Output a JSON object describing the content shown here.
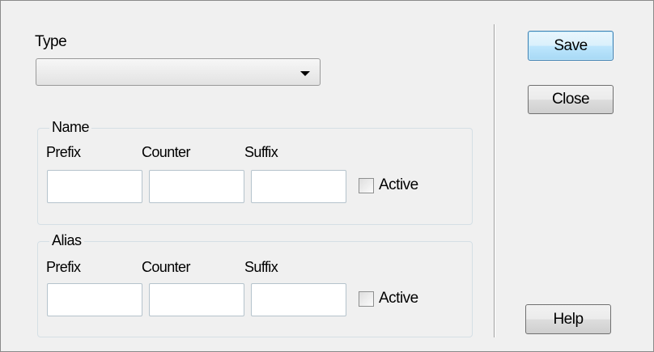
{
  "type_field": {
    "label": "Type",
    "value": ""
  },
  "name_group": {
    "title": "Name",
    "prefix_label": "Prefix",
    "counter_label": "Counter",
    "suffix_label": "Suffix",
    "prefix_value": "",
    "counter_value": "",
    "suffix_value": "",
    "active_label": "Active",
    "active_checked": false
  },
  "alias_group": {
    "title": "Alias",
    "prefix_label": "Prefix",
    "counter_label": "Counter",
    "suffix_label": "Suffix",
    "prefix_value": "",
    "counter_value": "",
    "suffix_value": "",
    "active_label": "Active",
    "active_checked": false
  },
  "buttons": {
    "save": "Save",
    "close": "Close",
    "help": "Help"
  },
  "colors": {
    "dialog_background": "#f0f0f0",
    "default_button_border": "#3c7fb1",
    "groupbox_border": "#d5dfe5"
  },
  "icons": {
    "type_dropdown": "chevron-down-icon"
  }
}
